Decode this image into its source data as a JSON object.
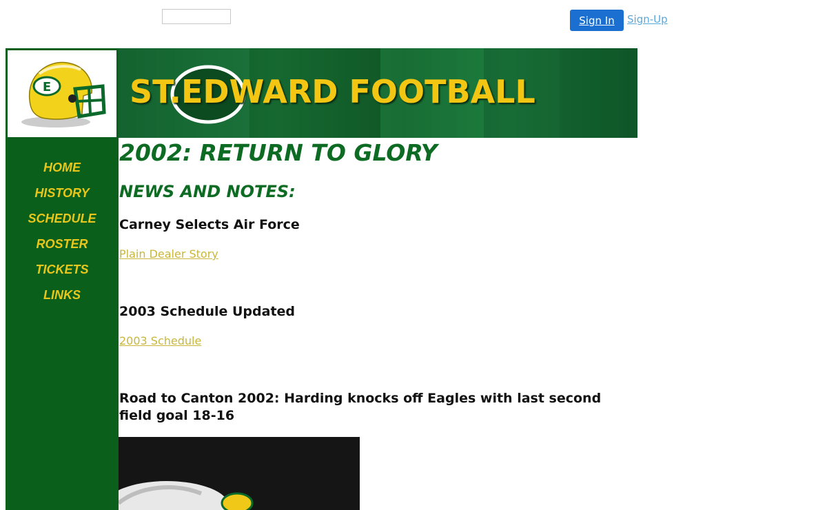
{
  "header": {
    "signin_label": "Sign In",
    "signup_label": "Sign-Up"
  },
  "banner": {
    "title": "ST.EDWARD FOOTBALL"
  },
  "nav": {
    "items": [
      {
        "label": "HOME"
      },
      {
        "label": "HISTORY"
      },
      {
        "label": "SCHEDULE"
      },
      {
        "label": "ROSTER"
      },
      {
        "label": "TICKETS"
      },
      {
        "label": "LINKS"
      }
    ]
  },
  "main": {
    "title": "2002: RETURN TO GLORY",
    "section_title": "NEWS AND NOTES:",
    "stories": [
      {
        "title": "Carney Selects Air Force",
        "link": "Plain Dealer Story"
      },
      {
        "title": "2003 Schedule Updated",
        "link": "2003 Schedule"
      },
      {
        "title": "Road to Canton 2002: Harding knocks off Eagles with last second field goal 18-16"
      }
    ]
  },
  "colors": {
    "brand_green": "#0a5f1a",
    "brand_gold": "#e8c61c",
    "link_gold": "#c9b73b",
    "signin_blue": "#1a6fd0"
  }
}
